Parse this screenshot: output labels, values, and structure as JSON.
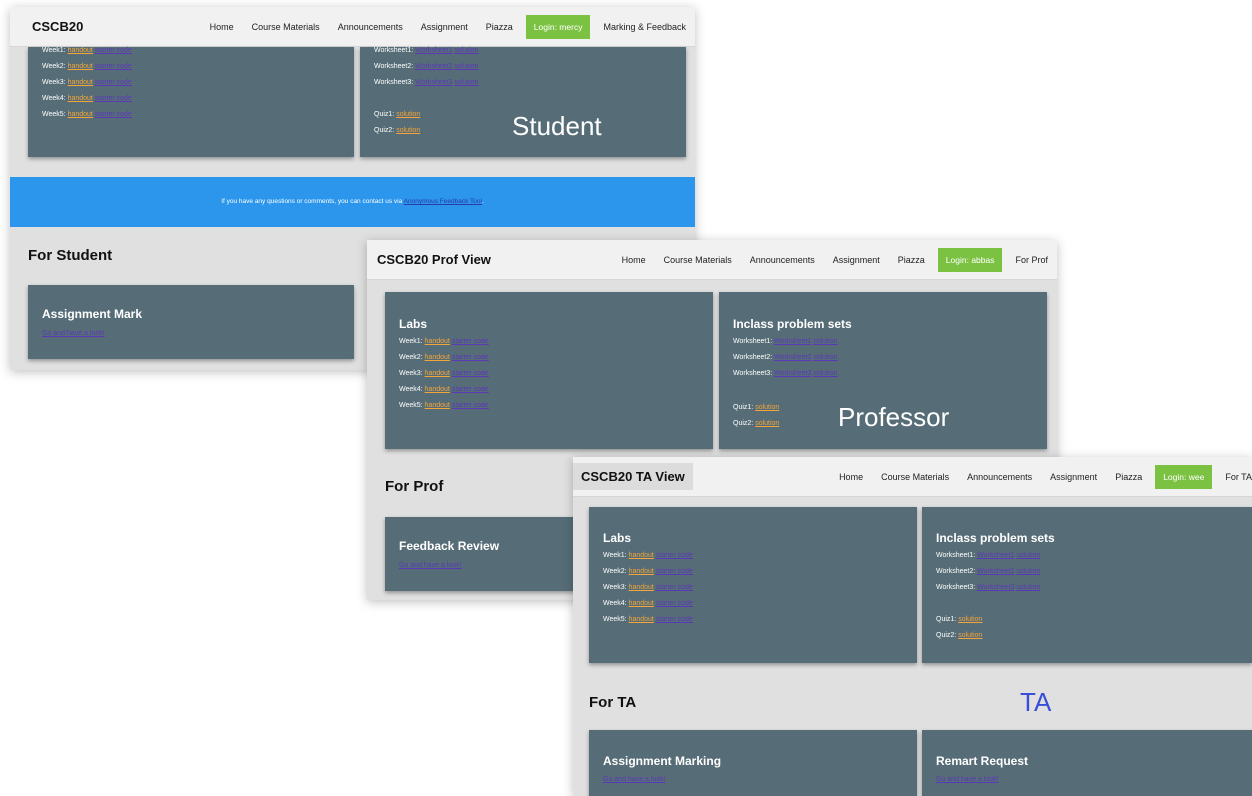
{
  "student": {
    "brand": "CSCB20",
    "nav": [
      "Home",
      "Course Materials",
      "Announcements",
      "Assignment",
      "Piazza"
    ],
    "login": "Login: mercy",
    "nav_extra": "Marking & Feedback",
    "label": "Student",
    "labs": [
      {
        "week": "Week1:",
        "handout": "handout",
        "starter": "starter code"
      },
      {
        "week": "Week2:",
        "handout": "handout",
        "starter": "starter code"
      },
      {
        "week": "Week3:",
        "handout": "handout",
        "starter": "starter code"
      },
      {
        "week": "Week4:",
        "handout": "handout",
        "starter": "starter code"
      },
      {
        "week": "Week5:",
        "handout": "handout",
        "starter": "starter code"
      }
    ],
    "worksheets": [
      {
        "label": "Worksheet1:",
        "link": "Worksheet1",
        "solution": "solution"
      },
      {
        "label": "Worksheet2:",
        "link": "Worksheet2",
        "solution": "solution"
      },
      {
        "label": "Worksheet3:",
        "link": "Worksheet3",
        "solution": "solution"
      }
    ],
    "quizzes": [
      {
        "label": "Quiz1:",
        "solution": "solution"
      },
      {
        "label": "Quiz2:",
        "solution": "solution"
      }
    ],
    "banner_text": "If you have any questions or comments, you can contact us via ",
    "banner_link": "Anonymous Feedback Tool",
    "banner_tail": ".",
    "section": "For Student",
    "card_title": "Assignment Mark",
    "card_link": "Go and have a look!"
  },
  "prof": {
    "brand": "CSCB20 Prof View",
    "nav": [
      "Home",
      "Course Materials",
      "Announcements",
      "Assignment",
      "Piazza"
    ],
    "login": "Login: abbas",
    "nav_extra": "For Prof",
    "label": "Professor",
    "labs_title": "Labs",
    "sets_title": "Inclass problem sets",
    "section": "For Prof",
    "card_title": "Feedback Review",
    "card_link": "Go and have a look!"
  },
  "ta": {
    "brand": "CSCB20 TA View",
    "nav": [
      "Home",
      "Course Materials",
      "Announcements",
      "Assignment",
      "Piazza"
    ],
    "login": "Login: wee",
    "nav_extra": "For TA",
    "label": "TA",
    "labs_title": "Labs",
    "sets_title": "Inclass problem sets",
    "section": "For TA",
    "card1_title": "Assignment Marking",
    "card1_link": "Go and have a look!",
    "card2_title": "Remart Request",
    "card2_link": "Go and have a look!"
  },
  "colors": {
    "card": "#566d77",
    "login": "#7cc242",
    "banner": "#2b96ec",
    "link_orange": "#f3a43a",
    "link_purple": "#5b38b8",
    "ta_label": "#3a4fd8"
  }
}
